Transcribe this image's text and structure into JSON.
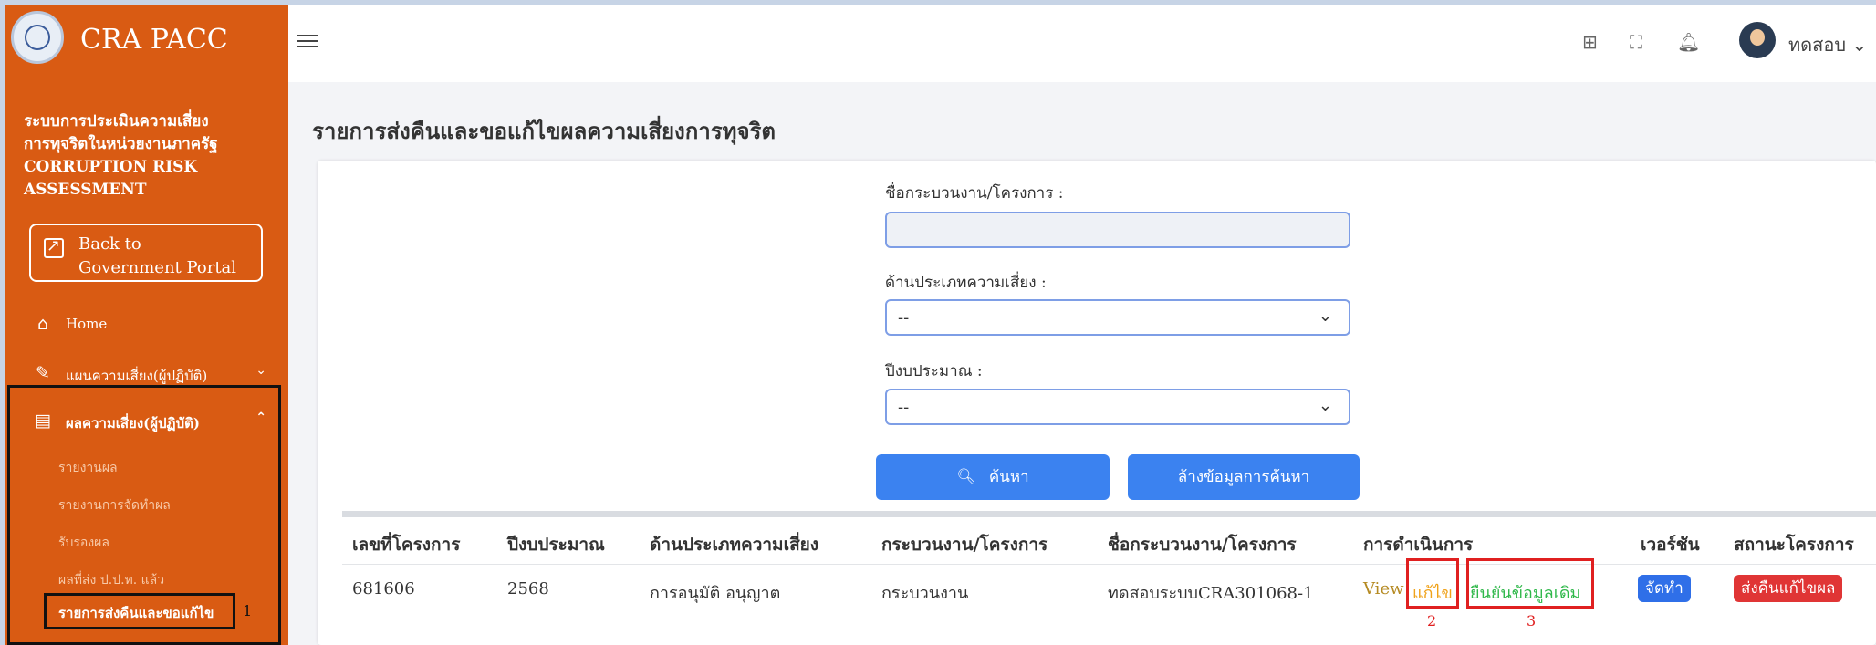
{
  "sidebar": {
    "brand": "CRA PACC",
    "system_name_lines": [
      "ระบบการประเมินความเสี่ยง",
      "การทุจริตในหน่วยงานภาครัฐ",
      "CORRUPTION RISK",
      "ASSESSMENT"
    ],
    "back_button": {
      "line1": "Back to",
      "line2": "Government Portal",
      "icon": "external-link-icon"
    },
    "nav": {
      "home": {
        "label": "Home",
        "icon": "home-icon"
      },
      "plan": {
        "label": "แผนความเสี่ยง(ผู้ปฏิบัติ)",
        "icon": "edit-icon"
      },
      "result": {
        "label": "ผลความเสี่ยง(ผู้ปฏิบัติ)",
        "icon": "document-icon"
      }
    },
    "sub_items": [
      "รายงานผล",
      "รายงานการจัดทำผล",
      "รับรองผล",
      "ผลที่ส่ง ป.ป.ท. แล้ว"
    ],
    "selected_sub_item": "รายการส่งคืนและขอแก้ไข",
    "marker": "1"
  },
  "topbar": {
    "menu_icon": "hamburger-icon",
    "icons": [
      "apps-icon",
      "fullscreen-icon",
      "bell-icon"
    ],
    "user_name": "ทดสอบ"
  },
  "page": {
    "title": "รายการส่งคืนและขอแก้ไขผลความเสี่ยงการทุจริต"
  },
  "filters": {
    "process_label": "ชื่อกระบวนงาน/โครงการ :",
    "process_value": "",
    "risk_type_label": "ด้านประเภทความเสี่ยง :",
    "risk_type_value": "--",
    "year_label": "ปีงบประมาณ :",
    "year_value": "--",
    "search_button": "ค้นหา",
    "clear_button": "ล้างข้อมูลการค้นหา"
  },
  "table": {
    "headers": [
      "เลขที่โครงการ",
      "ปีงบประมาณ",
      "ด้านประเภทความเสี่ยง",
      "กระบวนงาน/โครงการ",
      "ชื่อกระบวนงาน/โครงการ",
      "การดำเนินการ",
      "เวอร์ชัน",
      "สถานะโครงการ"
    ],
    "rows": [
      {
        "project_no": "681606",
        "year": "2568",
        "risk_type": "การอนุมัติ อนุญาต",
        "process": "กระบวนงาน",
        "process_name": "ทดสอบระบบCRA301068-1",
        "actions": {
          "view": "View",
          "edit": "แก้ไข",
          "confirm": "ยืนยันข้อมูลเดิม"
        },
        "version": "จัดทำ",
        "status": "ส่งคืนแก้ไขผล"
      }
    ],
    "markers": {
      "edit": "2",
      "confirm": "3"
    }
  }
}
